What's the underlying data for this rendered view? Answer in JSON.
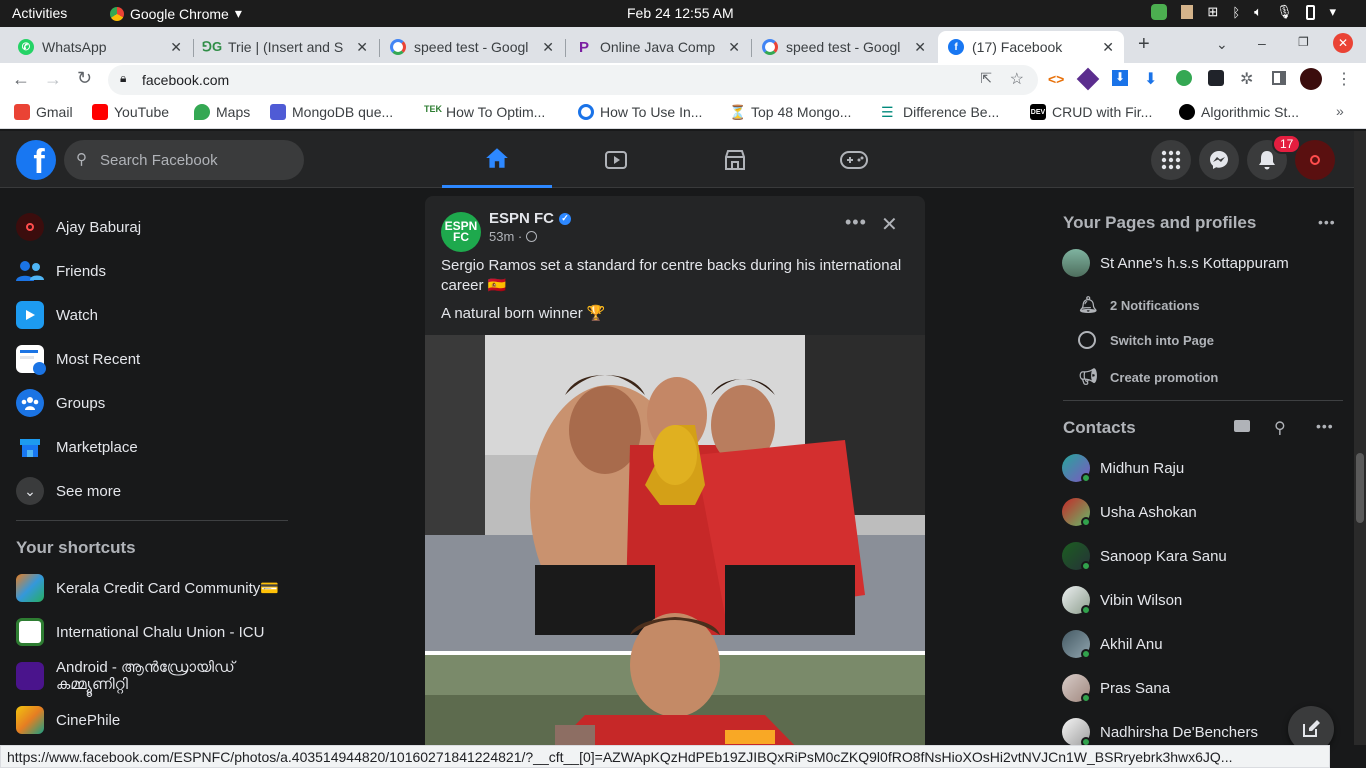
{
  "system_bar": {
    "activities": "Activities",
    "app_name": "Google Chrome",
    "clock": "Feb 24  12:55 AM"
  },
  "tabs": [
    {
      "title": "WhatsApp",
      "color": "#25d366"
    },
    {
      "title": "Trie | (Insert and S",
      "color": "#2f8d46"
    },
    {
      "title": "speed test - Googl",
      "color": "#4285f4"
    },
    {
      "title": "Online Java Comp",
      "color": "#7b1fa2"
    },
    {
      "title": "speed test - Googl",
      "color": "#4285f4"
    },
    {
      "title": "(17) Facebook",
      "color": "#1877f2"
    }
  ],
  "address": {
    "url": "facebook.com"
  },
  "bookmarks": [
    {
      "label": "Gmail",
      "color": "#ea4335"
    },
    {
      "label": "YouTube",
      "color": "#ff0000"
    },
    {
      "label": "Maps",
      "color": "#34a853"
    },
    {
      "label": "MongoDB que...",
      "color": "#4f5bd5"
    },
    {
      "label": "How To Optim...",
      "color": "#2e7d32"
    },
    {
      "label": "How To Use In...",
      "color": "#1a73e8"
    },
    {
      "label": "Top 48 Mongo...",
      "color": "#c62828"
    },
    {
      "label": "Difference Be...",
      "color": "#00897b"
    },
    {
      "label": "CRUD with Fir...",
      "color": "#000000"
    },
    {
      "label": "Algorithmic St...",
      "color": "#000000"
    }
  ],
  "fb": {
    "logo": "f",
    "search_placeholder": "Search Facebook",
    "notification_count": "17"
  },
  "left_menu": [
    {
      "label": "Ajay Baburaj",
      "icon": "avatar"
    },
    {
      "label": "Friends",
      "icon": "friends-icon"
    },
    {
      "label": "Watch",
      "icon": "watch-icon"
    },
    {
      "label": "Most Recent",
      "icon": "most-recent-icon"
    },
    {
      "label": "Groups",
      "icon": "groups-icon"
    },
    {
      "label": "Marketplace",
      "icon": "marketplace-icon"
    },
    {
      "label": "See more",
      "icon": "chevron-down-icon"
    }
  ],
  "shortcuts": {
    "title": "Your shortcuts",
    "items": [
      {
        "label": "Kerala Credit Card Community💳"
      },
      {
        "label": "International Chalu Union - ICU"
      },
      {
        "label": "Android - ആൻഡ്രോയിഡ് കമ്മ്യൂണിറ്റി"
      },
      {
        "label": "CinePhile"
      }
    ]
  },
  "post": {
    "avatar_text": "ESPN FC",
    "author": "ESPN FC",
    "time": "53m ·",
    "text1": "Sergio Ramos set a standard for centre backs during his international career 🇪🇸",
    "text2": "A natural born winner 🏆"
  },
  "pages": {
    "title": "Your Pages and profiles",
    "page_name": "St Anne's h.s.s Kottappuram",
    "actions": [
      "2 Notifications",
      "Switch into Page",
      "Create promotion"
    ]
  },
  "contacts": {
    "title": "Contacts",
    "items": [
      "Midhun Raju",
      "Usha Ashokan",
      "Sanoop Kara Sanu",
      "Vibin Wilson",
      "Akhil Anu",
      "Pras Sana",
      "Nadhirsha De'Benchers"
    ]
  },
  "status_url": "https://www.facebook.com/ESPNFC/photos/a.403514944820/10160271841224821/?__cft__[0]=AZWApKQzHdPEb19ZJIBQxRiPsM0cZKQ9l0fRO8fNsHioXOsHi2vtNVJCn1W_BSRryebrk3hwx6JQ..."
}
